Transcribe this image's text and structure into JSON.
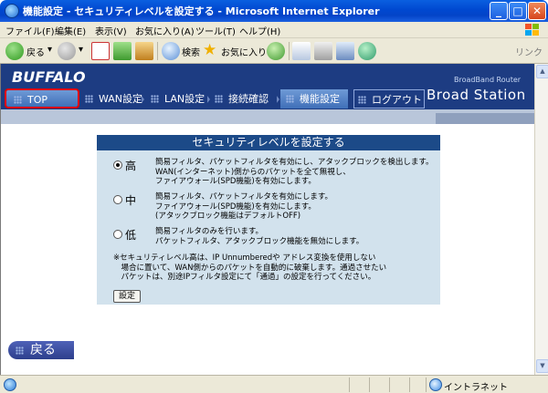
{
  "window": {
    "title": "機能設定 - セキュリティレベルを設定する - Microsoft Internet Explorer"
  },
  "menubar": {
    "items": [
      "ファイル(F)",
      "編集(E)",
      "表示(V)",
      "お気に入り(A)",
      "ツール(T)",
      "ヘルプ(H)"
    ]
  },
  "toolbar": {
    "back_label": "戻る",
    "search_label": "検索",
    "favorites_label": "お気に入り",
    "links_label": "リンク"
  },
  "header": {
    "logo": "BUFFALO",
    "router_small": "BroadBand Router",
    "router_big": "Broad Station",
    "nav": [
      "TOP",
      "WAN設定",
      "LAN設定",
      "接続確認",
      "機能設定",
      "ログアウト"
    ]
  },
  "panel": {
    "title": "セキュリティレベルを設定する",
    "options": [
      {
        "level": "高",
        "selected": true,
        "desc": [
          "簡易フィルタ、パケットフィルタを有効にし、アタックブロックを検出します。",
          "WAN(インターネット)側からのパケットを全て無視し、",
          "ファイアウォール(SPD機能)を有効にします。"
        ]
      },
      {
        "level": "中",
        "selected": false,
        "desc": [
          "簡易フィルタ、パケットフィルタを有効にします。",
          "ファイアウォール(SPD機能)を有効にします。",
          "(アタックブロック機能はデフォルトOFF)"
        ]
      },
      {
        "level": "低",
        "selected": false,
        "desc": [
          "簡易フィルタのみを行います。",
          "パケットフィルタ、アタックブロック機能を無効にします。"
        ]
      }
    ],
    "note": [
      "※セキュリティレベル高は、IP Unnumberedや アドレス変換を使用しない",
      "　場合に置いて、WAN側からのパケットを自動的に破棄します。通過させたい",
      "　パケットは、別途IPフィルタ設定にて「通過」の設定を行ってください。"
    ],
    "submit_label": "設定"
  },
  "back_button": "戻る",
  "statusbar": {
    "zone": "イントラネット"
  },
  "colors": {
    "titlebar": "#0048d0",
    "banner": "#1d3c82",
    "panel_bg": "#d2e2ed",
    "panel_title": "#1c4a88",
    "highlight_border": "#e00000"
  }
}
